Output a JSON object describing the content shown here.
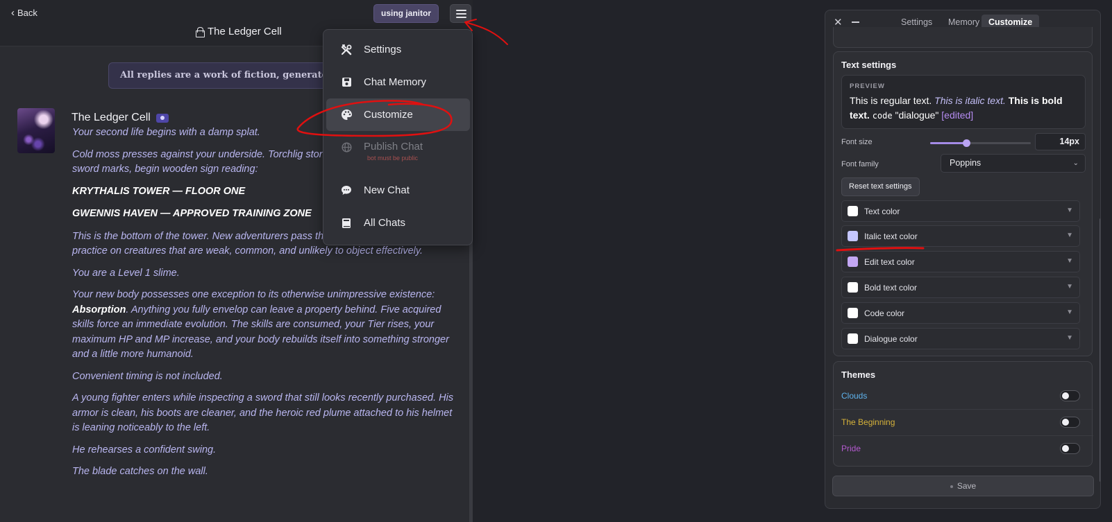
{
  "nav": {
    "back_label": "Back"
  },
  "chat": {
    "title": "The Ledger Cell",
    "janitor_button": "using janitor",
    "fiction_banner": "All replies are a work of fiction, generate",
    "character_name": "The Ledger Cell",
    "messages": [
      {
        "kind": "italic",
        "text": "Your second life begins with a damp splat."
      },
      {
        "kind": "italic",
        "text": "Cold moss presses against your underside. Torchlig stone corridor, catching on old sword marks, begin wooden sign reading:"
      },
      {
        "kind": "heading",
        "text": "KRYTHALIS TOWER — FLOOR ONE"
      },
      {
        "kind": "heading",
        "text": "GWENNIS HAVEN — APPROVED TRAINING ZONE"
      },
      {
        "kind": "italic",
        "text": "This is the bottom of the tower. New adventurers pass through these corridors to practice on creatures that are weak, common, and unlikely to object effectively."
      },
      {
        "kind": "italic",
        "text": "You are a Level 1 slime."
      },
      {
        "kind": "mixed",
        "before": "Your new body possesses one exception to its otherwise unimpressive existence: ",
        "bold": "Absorption",
        "after": ". Anything you fully envelop can leave a property behind. Five acquired skills force an immediate evolution. The skills are consumed, your Tier rises, your maximum HP and MP increase, and your body rebuilds itself into something stronger and a little more humanoid."
      },
      {
        "kind": "italic",
        "text": "Convenient timing is not included."
      },
      {
        "kind": "italic",
        "text": "A young fighter enters while inspecting a sword that still looks recently purchased. His armor is clean, his boots are cleaner, and the heroic red plume attached to his helmet is leaning noticeably to the left."
      },
      {
        "kind": "italic",
        "text": "He rehearses a confident swing."
      },
      {
        "kind": "italic",
        "text": "The blade catches on the wall."
      }
    ]
  },
  "menu": {
    "items": [
      {
        "label": "Settings",
        "icon": "tools-icon"
      },
      {
        "label": "Chat Memory",
        "icon": "save-icon"
      },
      {
        "label": "Customize",
        "icon": "palette-icon"
      },
      {
        "label": "Publish Chat",
        "icon": "globe-icon",
        "sublabel": "bot must be public"
      },
      {
        "label": "New Chat",
        "icon": "chat-bubble-icon"
      },
      {
        "label": "All Chats",
        "icon": "book-icon"
      }
    ]
  },
  "panel": {
    "tabs": [
      "Settings",
      "Memory",
      "Customize"
    ],
    "active_tab": "Customize",
    "text_settings": {
      "title": "Text settings",
      "preview_label": "PREVIEW",
      "preview": {
        "regular": "This is regular text.",
        "italic": "This is italic text.",
        "bold": "This is bold text.",
        "code": "code",
        "dialogue": "\"dialogue\"",
        "edited": "[edited]"
      },
      "font_size_label": "Font size",
      "font_size_value": "14px",
      "font_size_fraction": 0.36,
      "font_family_label": "Font family",
      "font_family_value": "Poppins",
      "reset_label": "Reset text settings",
      "colors": [
        {
          "label": "Text color",
          "swatch": "#ffffff"
        },
        {
          "label": "Italic text color",
          "swatch": "#c4c6ff"
        },
        {
          "label": "Edit text color",
          "swatch": "#c3a7f3"
        },
        {
          "label": "Bold text color",
          "swatch": "#ffffff"
        },
        {
          "label": "Code color",
          "swatch": "#ffffff"
        },
        {
          "label": "Dialogue color",
          "swatch": "#ffffff"
        }
      ]
    },
    "themes": {
      "title": "Themes",
      "items": [
        {
          "label": "Clouds",
          "color": "#5fb4ee",
          "enabled": false
        },
        {
          "label": "The Beginning",
          "color": "#d6b23a",
          "enabled": false
        },
        {
          "label": "Pride",
          "color": "#b55ad0",
          "enabled": false
        }
      ]
    },
    "save_label": "Save"
  },
  "colors": {
    "accent": "#a48be6",
    "annotation_red": "#e01010"
  }
}
